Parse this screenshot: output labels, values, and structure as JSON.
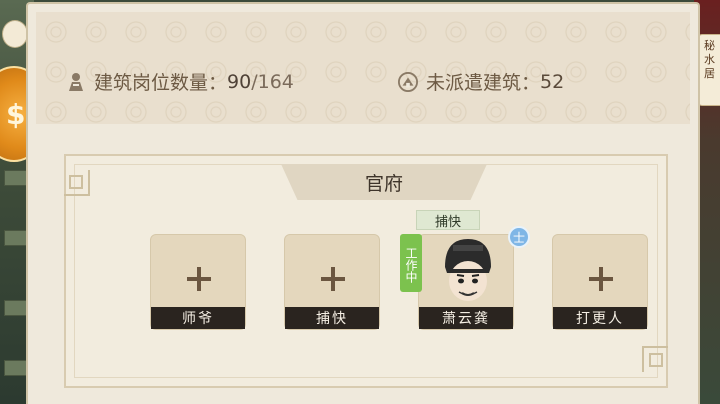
{
  "side": {
    "badge_text": "秘水居"
  },
  "header": {
    "post_count_label": "建筑岗位数量：",
    "post_count_current": "90",
    "post_count_total": "/164",
    "unassigned_label": "未派遣建筑：",
    "unassigned_value": "52"
  },
  "building": {
    "name": "官府",
    "slots": [
      {
        "label": "师爷",
        "filled": false
      },
      {
        "label": "捕快",
        "filled": false
      },
      {
        "label": "萧云龚",
        "filled": true,
        "role": "捕快",
        "status": "工作中",
        "rank": "士"
      },
      {
        "label": "打更人",
        "filled": false
      }
    ]
  },
  "colors": {
    "panel_bg": "#efe9dc",
    "label_bar": "#2a241f",
    "working_green": "#7cc24e",
    "rank_blue": "#7fb6e6",
    "coin_orange": "#e08a1a"
  }
}
